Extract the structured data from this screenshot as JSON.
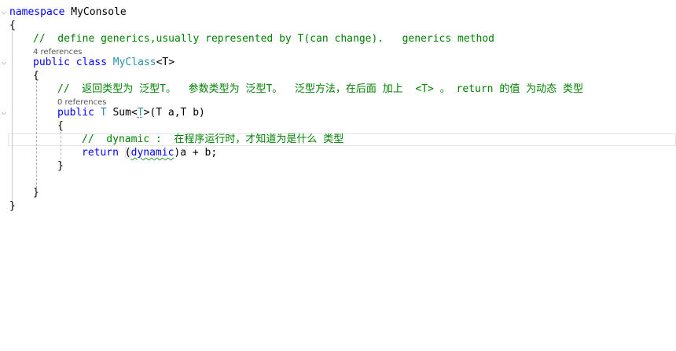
{
  "editor": {
    "lines": {
      "l1": {
        "kw": "namespace",
        "name": "MyConsole"
      },
      "l2": {
        "brace": "{"
      },
      "l3": {
        "comment": "//  define generics,usually represented by T(can change).   generics method"
      },
      "l3_refs": "4 references",
      "l4": {
        "kw1": "public",
        "kw2": "class",
        "name": "MyClass",
        "generic": "<T>"
      },
      "l5": {
        "brace": "{"
      },
      "l6": {
        "comment": "//  返回类型为 泛型T。  参数类型为 泛型T。  泛型方法，在后面 加上  <T> 。 return 的值 为动态 类型"
      },
      "l6_refs": "0 references",
      "l7": {
        "kw": "public",
        "t": "T",
        "name": "Sum",
        "lt": "<",
        "tp": "T",
        "gt": ">",
        "params": "(T a,T b)"
      },
      "l8": {
        "brace": "{"
      },
      "l9": {
        "comment": "//  dynamic :  在程序运行时，才知道为是什么 类型"
      },
      "l10": {
        "kw": "return",
        "open": "(",
        "dyn": "dynamic",
        "rest": ")a + b;"
      },
      "l11": {
        "brace": "}"
      },
      "l13": {
        "brace": "}"
      },
      "l14": {
        "brace": "}"
      }
    },
    "fold_glyphs": {
      "l1": "⌵",
      "l4": "⌵",
      "l7": "⌵"
    },
    "colors": {
      "keyword": "#0000ff",
      "type": "#2b91af",
      "comment": "#008000",
      "codelens": "#555555",
      "squiggle": "#2e9a2e"
    }
  }
}
